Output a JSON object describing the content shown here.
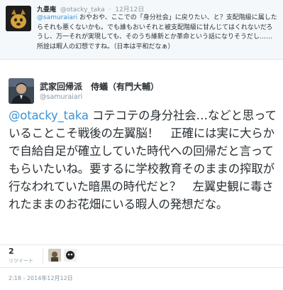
{
  "reply": {
    "name": "九畳庵",
    "handle": "@otacky_taka",
    "date": "12月12日",
    "mention": "@samuraiari",
    "text": " おやおや、ここでの「身分社会」に戻りたい、と？支配階級に属したらそれも悪くないかも。でも誰もおいそれと被支配階級に甘んじてはくれないだろうし、万一それが実現しても、そのうち維新とか革命という話になりそうだし……所詮は暇人の幻想ですね。（日本は平和だなぁ）"
  },
  "tweet": {
    "author_name": "武家回帰派　侍蟻（有門大輔）",
    "author_handle": "@samuraiari",
    "mention": "@otacky_taka",
    "text": " コテコテの身分社会…などと思っていることこそ戦後の左翼脳！　正確には実に大らかで自給自足が確立していた時代への回帰だと言ってもらいたいね。要するに学校教育そのままの搾取が行なわれていた暗黒の時代だと？　左翼史観に毒されたままのお花畑にいる暇人の発想だな。",
    "retweet_count": "2",
    "retweet_label": "リツイート",
    "timestamp": "2:18 - 2014年12月12日"
  },
  "icons": {
    "reply_avatar": "dog-avatar-icon",
    "author_avatar": "author-photo-avatar",
    "retweeter_1": "retweeter-avatar",
    "retweeter_2": "retweeter-avatar"
  },
  "colors": {
    "link": "#3b94d9",
    "muted": "#8899a6",
    "text": "#292f33",
    "reply_bg": "#f5f8fa"
  }
}
